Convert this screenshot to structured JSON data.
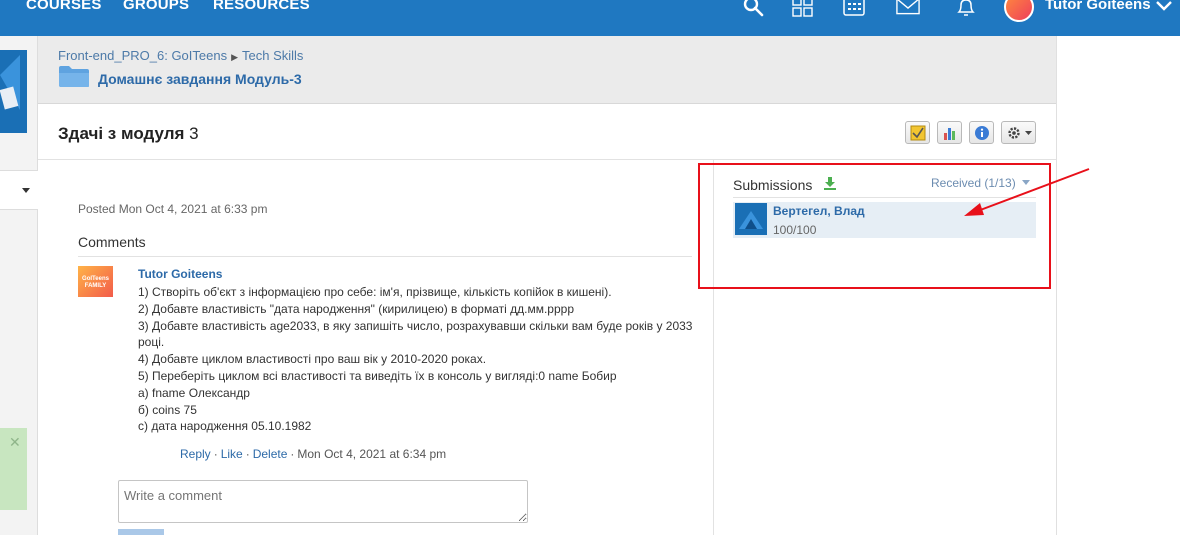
{
  "topnav": {
    "items": [
      "COURSES",
      "GROUPS",
      "RESOURCES"
    ],
    "user_name": "Tutor Goiteens",
    "icons": [
      "search-icon",
      "grid-icon",
      "calendar-icon",
      "mail-icon",
      "bell-icon",
      "chevron-down-icon"
    ],
    "accent": "#1f78c1"
  },
  "breadcrumb": {
    "group": "Front-end_PRO_6: GoITeens",
    "section": "Tech Skills"
  },
  "folder": {
    "title": "Домашнє завдання Модуль-3"
  },
  "assignment": {
    "title": "Здачі з модуля",
    "number": "3"
  },
  "post": {
    "posted": "Posted Mon Oct 4, 2021 at 6:33 pm"
  },
  "comments": {
    "heading": "Comments",
    "items": [
      {
        "author": "Tutor Goiteens",
        "avatar_text": "GoITeens FAMILY",
        "lines": [
          "1) Створіть об'єкт з інформацією про себе: ім'я, прізвище, кількість копійок в кишені).",
          "2) Добавте властивість \"дата народження\" (кирилицею) в форматі дд.мм.рррр",
          "3) Добавте властивість age2033, в яку запишіть число, розрахувавши скільки вам буде років у 2033",
          "році.",
          "4) Добавте циклом властивості про ваш вік у 2010-2020 роках.",
          "5) Переберіть циклом всі властивості та виведіть їх в консоль у вигляді:0 name Бобир",
          "а) fname Олександр",
          "б) coins 75",
          "с) дата народження 05.10.1982"
        ],
        "actions": {
          "reply": "Reply",
          "like": "Like",
          "delete": "Delete",
          "timestamp": "Mon Oct 4, 2021 at 6:34 pm"
        }
      }
    ],
    "write_placeholder": "Write a comment"
  },
  "submissions": {
    "heading": "Submissions",
    "filter": "Received (1/13)",
    "items": [
      {
        "name": "Вертегел, Влад",
        "score": "100/100"
      }
    ]
  },
  "colors": {
    "link": "#2d6aa8",
    "highlight": "#e8101a",
    "row_bg": "#e6eef5"
  }
}
